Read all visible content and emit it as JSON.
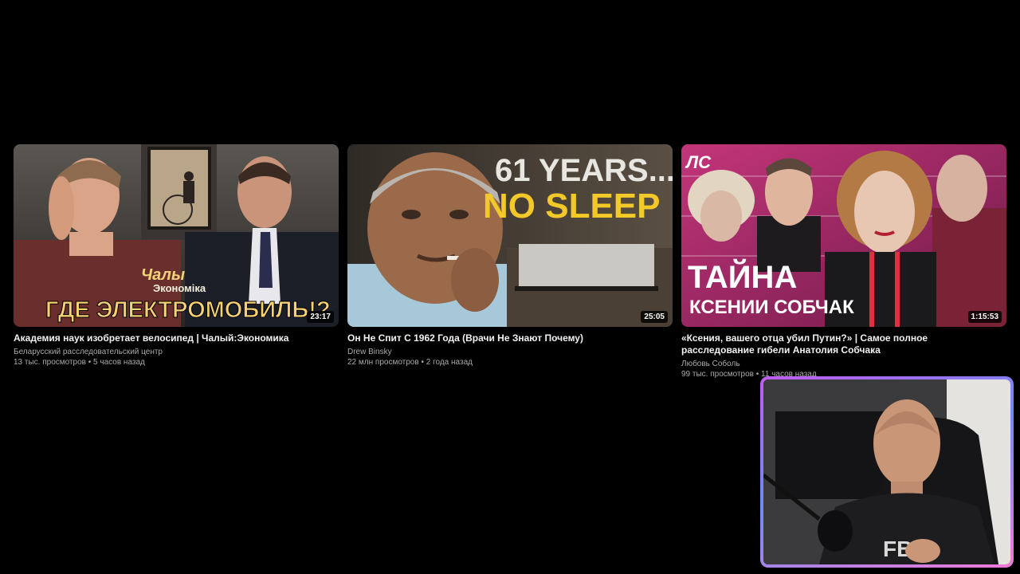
{
  "videos": [
    {
      "title": "Академия наук изобретает велосипед | Чалый:Экономика",
      "channel": "Беларусский расследовательский центр",
      "meta": "13 тыс. просмотров • 5 часов назад",
      "duration": "23:17",
      "thumb_text": {
        "line1": "Чалы",
        "line2": "Экономіка",
        "line3": "ГДЕ ЭЛЕКТРОМОБИЛЬ!?"
      }
    },
    {
      "title": "Он Не Спит С 1962 Года (Врачи Не Знают Почему)",
      "channel": "Drew Binsky",
      "meta": "22 млн просмотров • 2 года назад",
      "duration": "25:05",
      "thumb_text": {
        "line1": "61 YEARS...",
        "line2": "NO SLEEP"
      }
    },
    {
      "title": "«Ксения, вашего отца убил Путин?» | Самое полное расследование гибели Анатолия Собчака",
      "channel": "Любовь Соболь",
      "meta": "99 тыс. просмотров • 11 часов назад",
      "duration": "1:15:53",
      "thumb_text": {
        "logo": "ЛС",
        "line1": "ТАЙНА",
        "line2": "КСЕНИИ СОБЧАК"
      }
    }
  ],
  "webcam": {
    "shirt_text": "FBI"
  }
}
